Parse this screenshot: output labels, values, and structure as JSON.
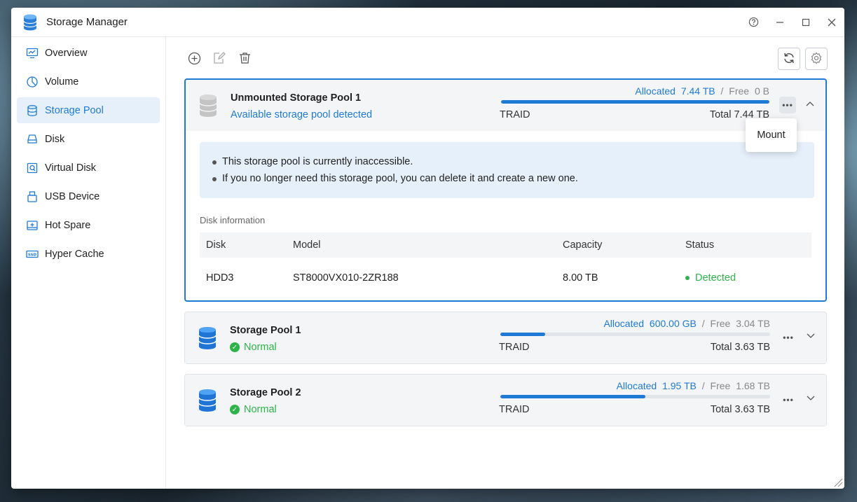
{
  "window": {
    "title": "Storage Manager"
  },
  "sidebar": {
    "items": [
      {
        "label": "Overview",
        "icon": "monitor-chart-icon",
        "active": false
      },
      {
        "label": "Volume",
        "icon": "volume-pie-icon",
        "active": false
      },
      {
        "label": "Storage Pool",
        "icon": "database-icon",
        "active": true
      },
      {
        "label": "Disk",
        "icon": "hard-disk-icon",
        "active": false
      },
      {
        "label": "Virtual Disk",
        "icon": "virtual-disk-icon",
        "active": false
      },
      {
        "label": "USB Device",
        "icon": "usb-icon",
        "active": false
      },
      {
        "label": "Hot Spare",
        "icon": "hot-spare-icon",
        "active": false
      },
      {
        "label": "Hyper Cache",
        "icon": "ssd-icon",
        "active": false
      }
    ]
  },
  "toolbar": {
    "add_icon": "add-circle-icon",
    "edit_icon": "edit-icon",
    "delete_icon": "trash-icon",
    "refresh_icon": "refresh-icon",
    "settings_icon": "gear-icon"
  },
  "pools": [
    {
      "name": "Unmounted Storage Pool 1",
      "subtitle": "Available storage pool detected",
      "allocated_label": "Allocated",
      "allocated": "7.44 TB",
      "free_label": "Free",
      "free": "0 B",
      "usage_fraction": 1.0,
      "raid": "TRAID",
      "total": "Total 7.44 TB",
      "expanded": true,
      "notices": [
        "This storage pool is currently inaccessible.",
        "If you no longer need this storage pool, you can delete it and create a new one."
      ],
      "disk_info_caption": "Disk information",
      "disk_columns": [
        "Disk",
        "Model",
        "Capacity",
        "Status"
      ],
      "disks": [
        {
          "disk": "HDD3",
          "model": "ST8000VX010-2ZR188",
          "capacity": "8.00 TB",
          "status": "Detected"
        }
      ]
    },
    {
      "name": "Storage Pool 1",
      "subtitle": "Normal",
      "allocated_label": "Allocated",
      "allocated": "600.00 GB",
      "free_label": "Free",
      "free": "3.04 TB",
      "usage_fraction": 0.165,
      "raid": "TRAID",
      "total": "Total 3.63 TB",
      "expanded": false
    },
    {
      "name": "Storage Pool 2",
      "subtitle": "Normal",
      "allocated_label": "Allocated",
      "allocated": "1.95 TB",
      "free_label": "Free",
      "free": "1.68 TB",
      "usage_fraction": 0.537,
      "raid": "TRAID",
      "total": "Total 3.63 TB",
      "expanded": false
    }
  ],
  "popover": {
    "mount_label": "Mount"
  },
  "colors": {
    "accent": "#1f7ad6",
    "ok": "#2eb34a"
  }
}
